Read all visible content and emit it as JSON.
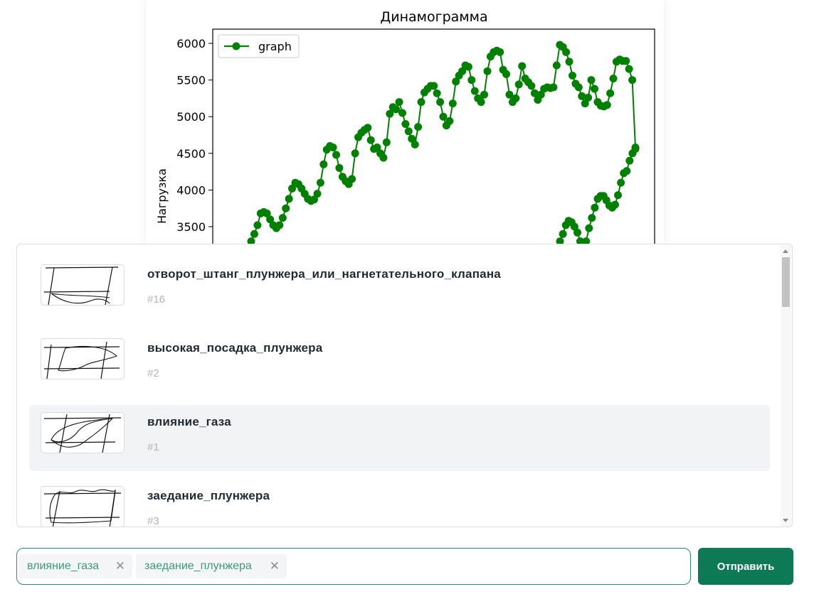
{
  "chart": {
    "title": "Динамограмма",
    "ylabel": "Нагрузка",
    "legend": "graph",
    "yticks": [
      "6000",
      "5500",
      "5000",
      "4500",
      "4000",
      "3500"
    ]
  },
  "chart_data": {
    "type": "line",
    "title": "Динамограмма",
    "ylabel": "Нагрузка",
    "xlabel": "",
    "series": [
      {
        "name": "graph",
        "color": "#008000",
        "marker": "circle"
      }
    ],
    "ylim": [
      3000,
      6200
    ],
    "legend_position": "top-left",
    "upper_stroke_y": [
      3300,
      3400,
      3520,
      3680,
      3700,
      3680,
      3600,
      3520,
      3480,
      3520,
      3620,
      3750,
      3880,
      4020,
      4100,
      4080,
      4020,
      3950,
      3880,
      3850,
      3870,
      3950,
      4100,
      4350,
      4550,
      4600,
      4580,
      4480,
      4300,
      4180,
      4120,
      4080,
      4150,
      4500,
      4720,
      4780,
      4820,
      4850,
      4680,
      4560,
      4580,
      4500,
      4440,
      4650,
      5040,
      5130,
      5100,
      5200,
      5050,
      4900,
      4800,
      4700,
      4620,
      4860,
      5200,
      5330,
      5380,
      5420,
      5420,
      5320,
      5200,
      5000,
      4880,
      4940,
      5180,
      5480,
      5560,
      5620,
      5700,
      5680,
      5500,
      5350,
      5250,
      5200,
      5300,
      5620,
      5820,
      5880,
      5900,
      5880,
      5640,
      5580,
      5300,
      5200,
      5250,
      5440,
      5690,
      5520,
      5470,
      5420,
      5320,
      5230,
      5300,
      5380,
      5400,
      5390,
      5400,
      5700,
      5980,
      5950,
      5880,
      5750,
      5560,
      5450,
      5400,
      5280,
      5180,
      5260,
      5500,
      5380,
      5200,
      5150,
      5140,
      5160,
      5320,
      5520,
      5750,
      5780,
      5760,
      5760,
      5650,
      5500,
      4580
    ],
    "lower_stroke_y": [
      3300,
      3400,
      3520,
      3580,
      3560,
      3500,
      3420,
      3300,
      3260,
      3300,
      3480,
      3620,
      3760,
      3880,
      3920,
      3920,
      3860,
      3790,
      3760,
      3800,
      3930,
      4100,
      4230,
      4260,
      4400,
      4500,
      4560
    ]
  },
  "options": [
    {
      "title": "отворот_штанг_плунжера_или_нагнетательного_клапана",
      "id": "#16",
      "thumb_icon": "dynamogram-rod-break-icon"
    },
    {
      "title": "высокая_посадка_плунжера",
      "id": "#2",
      "thumb_icon": "dynamogram-high-plunger-icon"
    },
    {
      "title": "влияние_газа",
      "id": "#1",
      "thumb_icon": "dynamogram-gas-influence-icon"
    },
    {
      "title": "заедание_плунжера",
      "id": "#3",
      "thumb_icon": "dynamogram-plunger-sticking-icon"
    }
  ],
  "selected_tags": [
    {
      "label": "влияние_газа"
    },
    {
      "label": "заедание_плунжера"
    }
  ],
  "tag_remove_glyph": "✕",
  "submit_label": "Отправить",
  "colors": {
    "accent": "#0d7a55",
    "tag_text": "#3f9a78",
    "line": "#008000",
    "hover_row": "#f2f3f5"
  }
}
